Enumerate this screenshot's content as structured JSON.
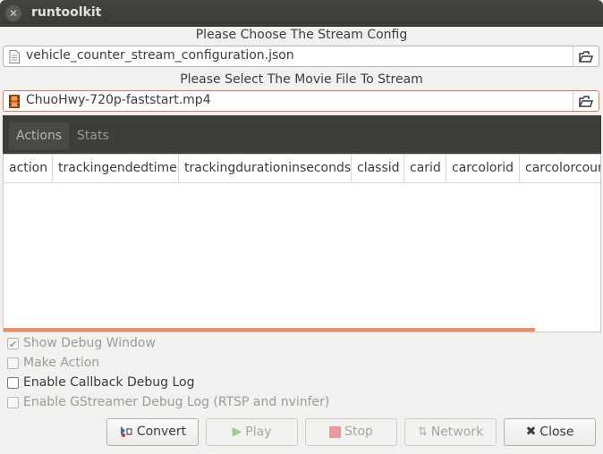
{
  "window": {
    "title": "runtoolkit"
  },
  "config": {
    "label": "Please Choose The Stream Config",
    "file": "vehicle_counter_stream_configuration.json"
  },
  "movie": {
    "label": "Please Select The Movie File To Stream",
    "file": "ChuoHwy-720p-faststart.mp4"
  },
  "tabs": [
    {
      "label": "Actions"
    },
    {
      "label": "Stats"
    }
  ],
  "table": {
    "columns": [
      "action",
      "trackingendedtime",
      "trackingdurationinseconds",
      "classid",
      "carid",
      "carcolorid",
      "carcolorcour"
    ]
  },
  "options": [
    {
      "label": "Show Debug Window"
    },
    {
      "label": "Make Action"
    },
    {
      "label": "Enable Callback Debug Log"
    },
    {
      "label": "Enable GStreamer Debug Log (RTSP and nvinfer)"
    }
  ],
  "buttons": {
    "convert": "Convert",
    "play": "Play",
    "stop": "Stop",
    "network": "Network",
    "close": "Close"
  },
  "colors": {
    "accent": "#f08b66",
    "titlebar": "#3b3a36",
    "tabbar": "#3f3d3a"
  }
}
